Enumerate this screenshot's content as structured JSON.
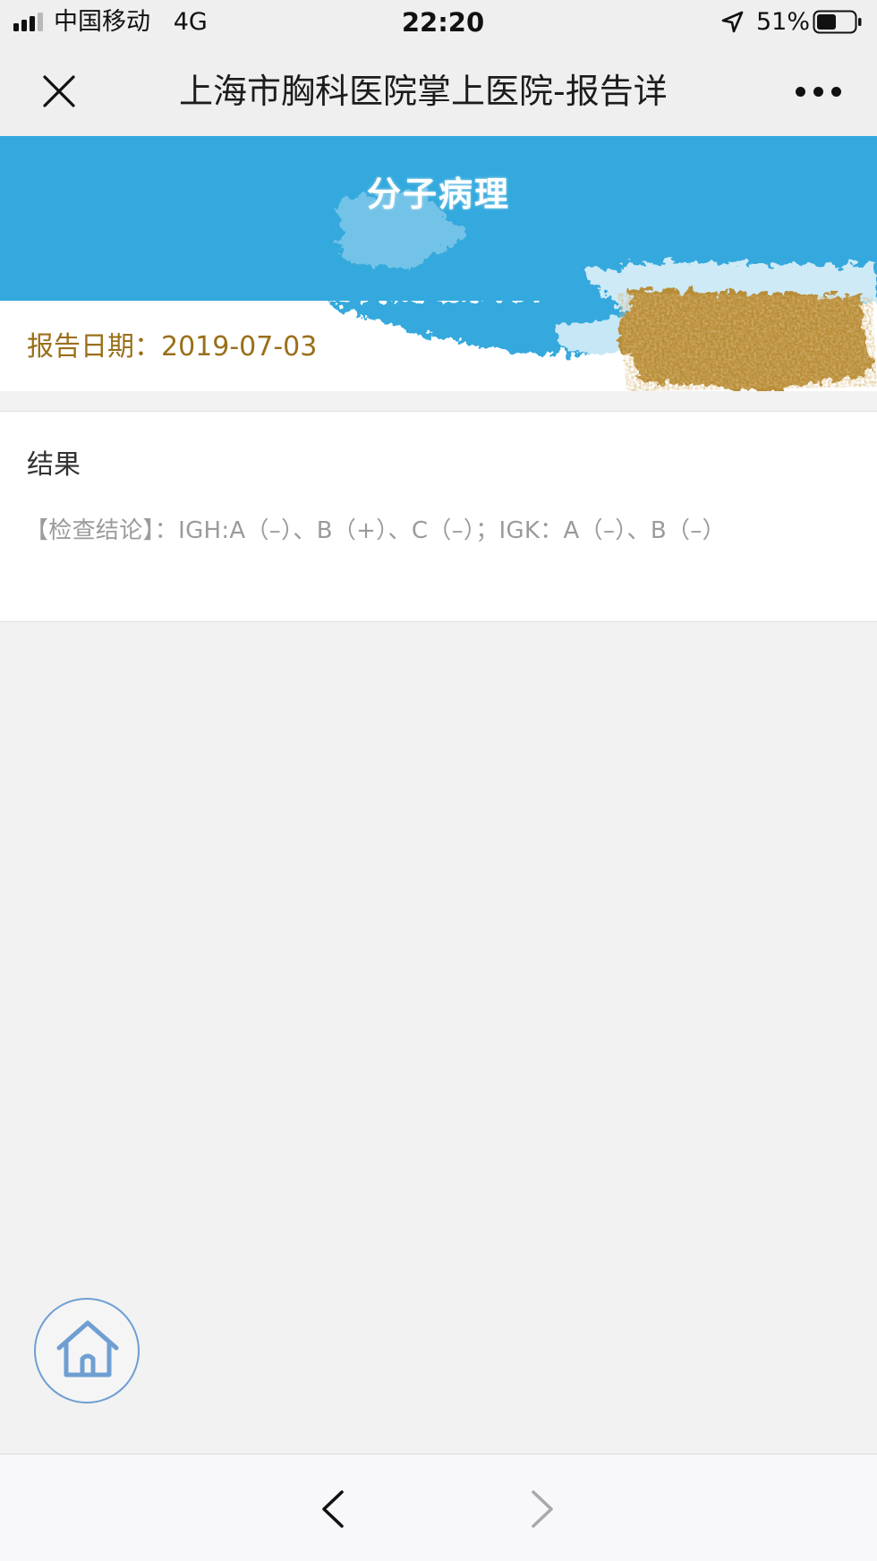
{
  "status_bar": {
    "carrier": "中国移动",
    "network": "4G",
    "time": "22:20",
    "battery": "51%",
    "battery_level": 0.51,
    "signal_bars_filled": 3,
    "signal_bars_total": 4,
    "icons": [
      "signal-icon",
      "location-arrow-icon",
      "battery-icon"
    ]
  },
  "nav_bar": {
    "title": "上海市胸科医院掌上医院-报告详",
    "icons": [
      "close-icon",
      "more-icon"
    ]
  },
  "banner": {
    "title": "分子病理",
    "report_date_label": "报告日期：",
    "report_date": "2019-07-03"
  },
  "result": {
    "heading": "结果",
    "conclusion": "【检查结论】：IGH:A（–）、B（+）、C（–）；IGK：A（–）、B（–）"
  },
  "floating": {
    "icons": [
      "home-icon"
    ]
  },
  "toolbar": {
    "icons": [
      "back-arrow-icon",
      "forward-arrow-icon"
    ]
  },
  "colors": {
    "banner_blue": "#34a9dd",
    "date_gold": "#9a6f1a",
    "home_blue": "#6f9fd2"
  }
}
